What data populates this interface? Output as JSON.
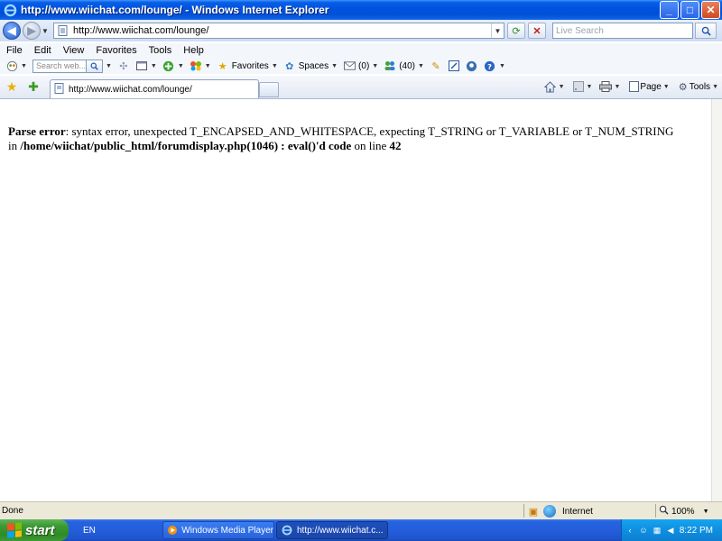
{
  "window": {
    "title": "http://www.wiichat.com/lounge/ - Windows Internet Explorer",
    "buttons": {
      "minimize": "_",
      "maximize": "□",
      "close": "✕"
    }
  },
  "nav": {
    "address": "http://www.wiichat.com/lounge/",
    "search_placeholder": "Live Search"
  },
  "menu": [
    "File",
    "Edit",
    "View",
    "Favorites",
    "Tools",
    "Help"
  ],
  "linksbar": {
    "search_placeholder": "Search web...",
    "favorites_label": "Favorites",
    "spaces_label": "Spaces",
    "mail_count": "(0)",
    "contacts_count": "(40)"
  },
  "tabs": [
    {
      "label": "http://www.wiichat.com/lounge/"
    }
  ],
  "commandbar": {
    "page_label": "Page",
    "tools_label": "Tools"
  },
  "content": {
    "line1_bold": "Parse error",
    "line1_rest": ": syntax error, unexpected T_ENCAPSED_AND_WHITESPACE, expecting T_STRING or T_VARIABLE or T_NUM_STRING",
    "line2_prefix": "in ",
    "line2_path": "/home/wiichat/public_html/forumdisplay.php(1046) : eval()'d code",
    "line2_mid": " on line ",
    "line2_line": "42"
  },
  "status": {
    "text": "Done",
    "zone": "Internet",
    "zoom": "100%"
  },
  "taskbar": {
    "start_label": "start",
    "language": "EN",
    "tasks": [
      {
        "label": "Windows Media Player"
      },
      {
        "label": "http://www.wiichat.c..."
      }
    ],
    "clock": "8:22 PM"
  },
  "colors": {
    "titlebar": "#0053e1",
    "taskbar": "#245edb",
    "start": "#3c9a34",
    "tray": "#0f8ee0",
    "chrome": "#dbe6f7"
  }
}
